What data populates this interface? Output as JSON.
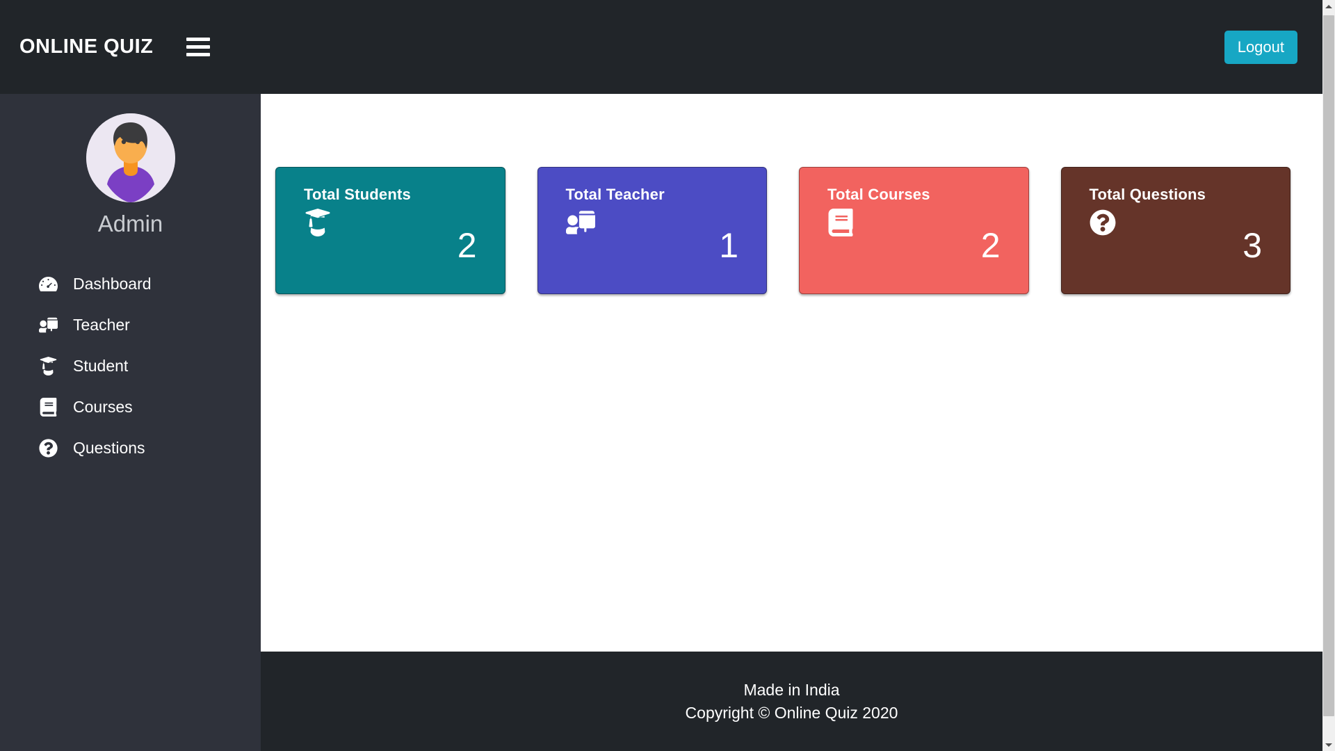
{
  "navbar": {
    "brand": "ONLINE QUIZ",
    "menu_icon": "hamburger-icon",
    "logout_label": "Logout",
    "logout_color": "#17a7c4",
    "background": "#212529"
  },
  "sidebar": {
    "background": "#2f323b",
    "avatar_alt": "admin-avatar",
    "user_name": "Admin",
    "items": [
      {
        "label": "Dashboard",
        "icon": "tachometer-icon"
      },
      {
        "label": "Teacher",
        "icon": "chalkboard-teacher-icon"
      },
      {
        "label": "Student",
        "icon": "user-graduate-icon"
      },
      {
        "label": "Courses",
        "icon": "book-icon"
      },
      {
        "label": "Questions",
        "icon": "question-circle-icon"
      }
    ]
  },
  "main": {
    "cards": [
      {
        "title": "Total Students",
        "value": "2",
        "icon": "user-graduate-icon",
        "color": "#08818a"
      },
      {
        "title": "Total Teacher",
        "value": "1",
        "icon": "chalkboard-teacher-icon",
        "color": "#4c4cc4"
      },
      {
        "title": "Total Courses",
        "value": "2",
        "icon": "book-icon",
        "color": "#f2635f"
      },
      {
        "title": "Total Questions",
        "value": "3",
        "icon": "question-circle-icon",
        "color": "#653429"
      }
    ]
  },
  "footer": {
    "background": "#212529",
    "line1": "Made in India",
    "line2": "Copyright © Online Quiz 2020"
  },
  "scrollbar": {
    "up_arrow": "scroll-up-arrow",
    "down_arrow": "scroll-down-arrow"
  }
}
